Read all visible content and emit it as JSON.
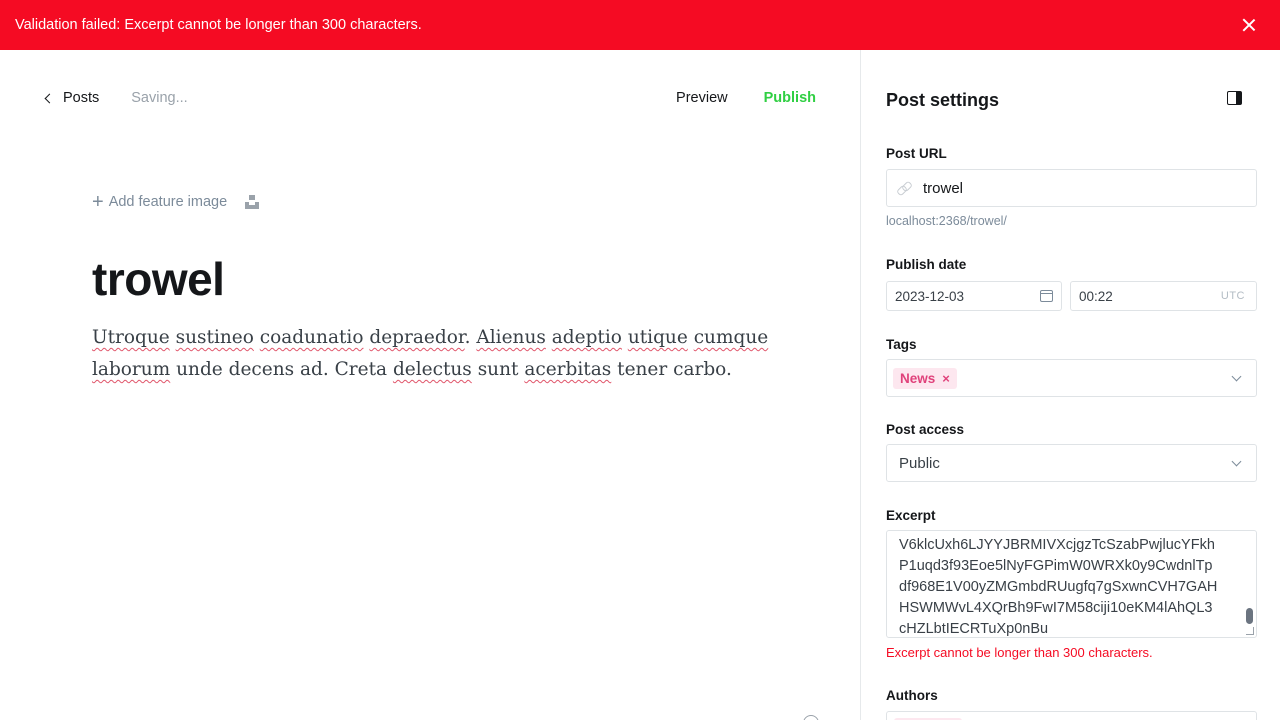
{
  "alert": {
    "message": "Validation failed: Excerpt cannot be longer than 300 characters.",
    "icon": "close-icon"
  },
  "editor": {
    "back_label": "Posts",
    "status": "Saving...",
    "preview_label": "Preview",
    "publish_label": "Publish",
    "feature_image_label": "Add feature image",
    "title": "trowel",
    "body": {
      "line1": [
        "Utroque",
        " ",
        "sustineo",
        " ",
        "coadunatio",
        " ",
        "depraedor",
        ". ",
        "Alienus",
        " ",
        "adeptio",
        " ",
        "utique",
        " ",
        "cumque"
      ],
      "line2": [
        "laborum",
        " unde decens ad. Creta ",
        "delectus",
        " sunt ",
        "acerbitas",
        " tener carbo."
      ]
    }
  },
  "settings": {
    "title": "Post settings",
    "post_url": {
      "label": "Post URL",
      "value": "trowel",
      "hint": "localhost:2368/trowel/"
    },
    "publish_date": {
      "label": "Publish date",
      "date": "2023-12-03",
      "time": "00:22",
      "timezone": "UTC"
    },
    "tags": {
      "label": "Tags",
      "items": [
        {
          "name": "News",
          "remove": "×"
        }
      ]
    },
    "post_access": {
      "label": "Post access",
      "value": "Public"
    },
    "excerpt": {
      "label": "Excerpt",
      "lines": [
        "V6klcUxh6LJYYJBRMIVXcjgzTcSzabPwjlucYFkh",
        "P1uqd3f93Eoe5lNyFGPimW0WRXk0y9CwdnlTp",
        "df968E1V00yZMGmbdRUugfq7gSxwnCVH7GAH",
        "HSWMWvL4XQrBh9FwI7M58ciji10eKM4lAhQL3",
        "cHZLbtIECRTuXp0nBu"
      ],
      "error": "Excerpt cannot be longer than 300 characters."
    },
    "authors": {
      "label": "Authors"
    }
  },
  "colors": {
    "alert_bg": "#f50b23",
    "publish": "#30cf43",
    "tag_bg": "#fde7ef",
    "tag_text": "#e0427b"
  }
}
